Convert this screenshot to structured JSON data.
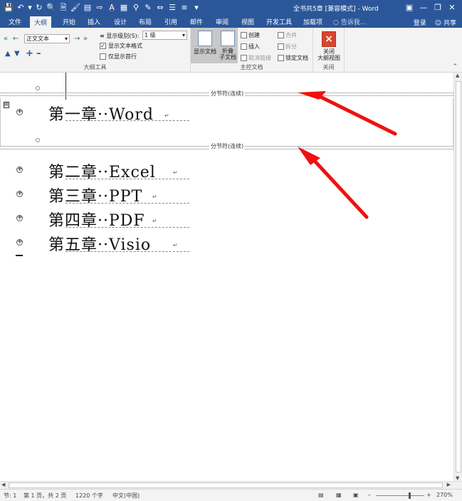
{
  "window": {
    "title": "全书共5章 [兼容模式] - Word",
    "qat_icons": [
      "save-icon",
      "undo-icon",
      "redo-icon",
      "print-preview-icon",
      "new-doc-icon",
      "format-painter-icon",
      "paragraph-icon",
      "insert-icon",
      "font-color-icon",
      "table-icon",
      "search-icon",
      "draw-icon",
      "spacing-icon",
      "list-icon",
      "bullet-icon",
      "customize-icon"
    ],
    "controls": [
      "ribbon-display-icon",
      "minimize-icon",
      "restore-icon",
      "close-icon"
    ]
  },
  "tabs": [
    "文件",
    "大纲",
    "开始",
    "插入",
    "设计",
    "布局",
    "引用",
    "邮件",
    "审阅",
    "视图",
    "开发工具",
    "加载项"
  ],
  "active_tab": "大纲",
  "tellme": "告诉我...",
  "login": "登录",
  "share": "共享",
  "ribbon": {
    "outline_tools": {
      "level_select": "正文文本",
      "show_level_label": "显示级别(S):",
      "show_level_value": "1 级",
      "show_text_format": "显示文本格式",
      "show_text_format_checked": true,
      "show_first_line": "仅显示首行",
      "show_first_line_checked": false,
      "group_label": "大纲工具"
    },
    "master_doc": {
      "show_doc": "显示文档",
      "collapse_sub": "折叠\n子文档",
      "create": "创建",
      "insert": "插入",
      "unlink": "取消链接",
      "merge": "合并",
      "split": "拆分",
      "lock": "锁定文档",
      "group_label": "主控文档"
    },
    "close": {
      "button": "关闭\n大纲视图",
      "group_label": "关闭"
    }
  },
  "document": {
    "section_break": "分节符(连续)",
    "chapters": [
      {
        "text": "第一章··Word"
      },
      {
        "text": "第二章··Excel"
      },
      {
        "text": "第三章··PPT"
      },
      {
        "text": "第四章··PDF"
      },
      {
        "text": "第五章··Visio"
      }
    ]
  },
  "status": {
    "section": "节: 1",
    "page": "第 1 页，共 2 页",
    "words": "1220 个字",
    "language": "中文(中国)",
    "zoom": "270%"
  }
}
